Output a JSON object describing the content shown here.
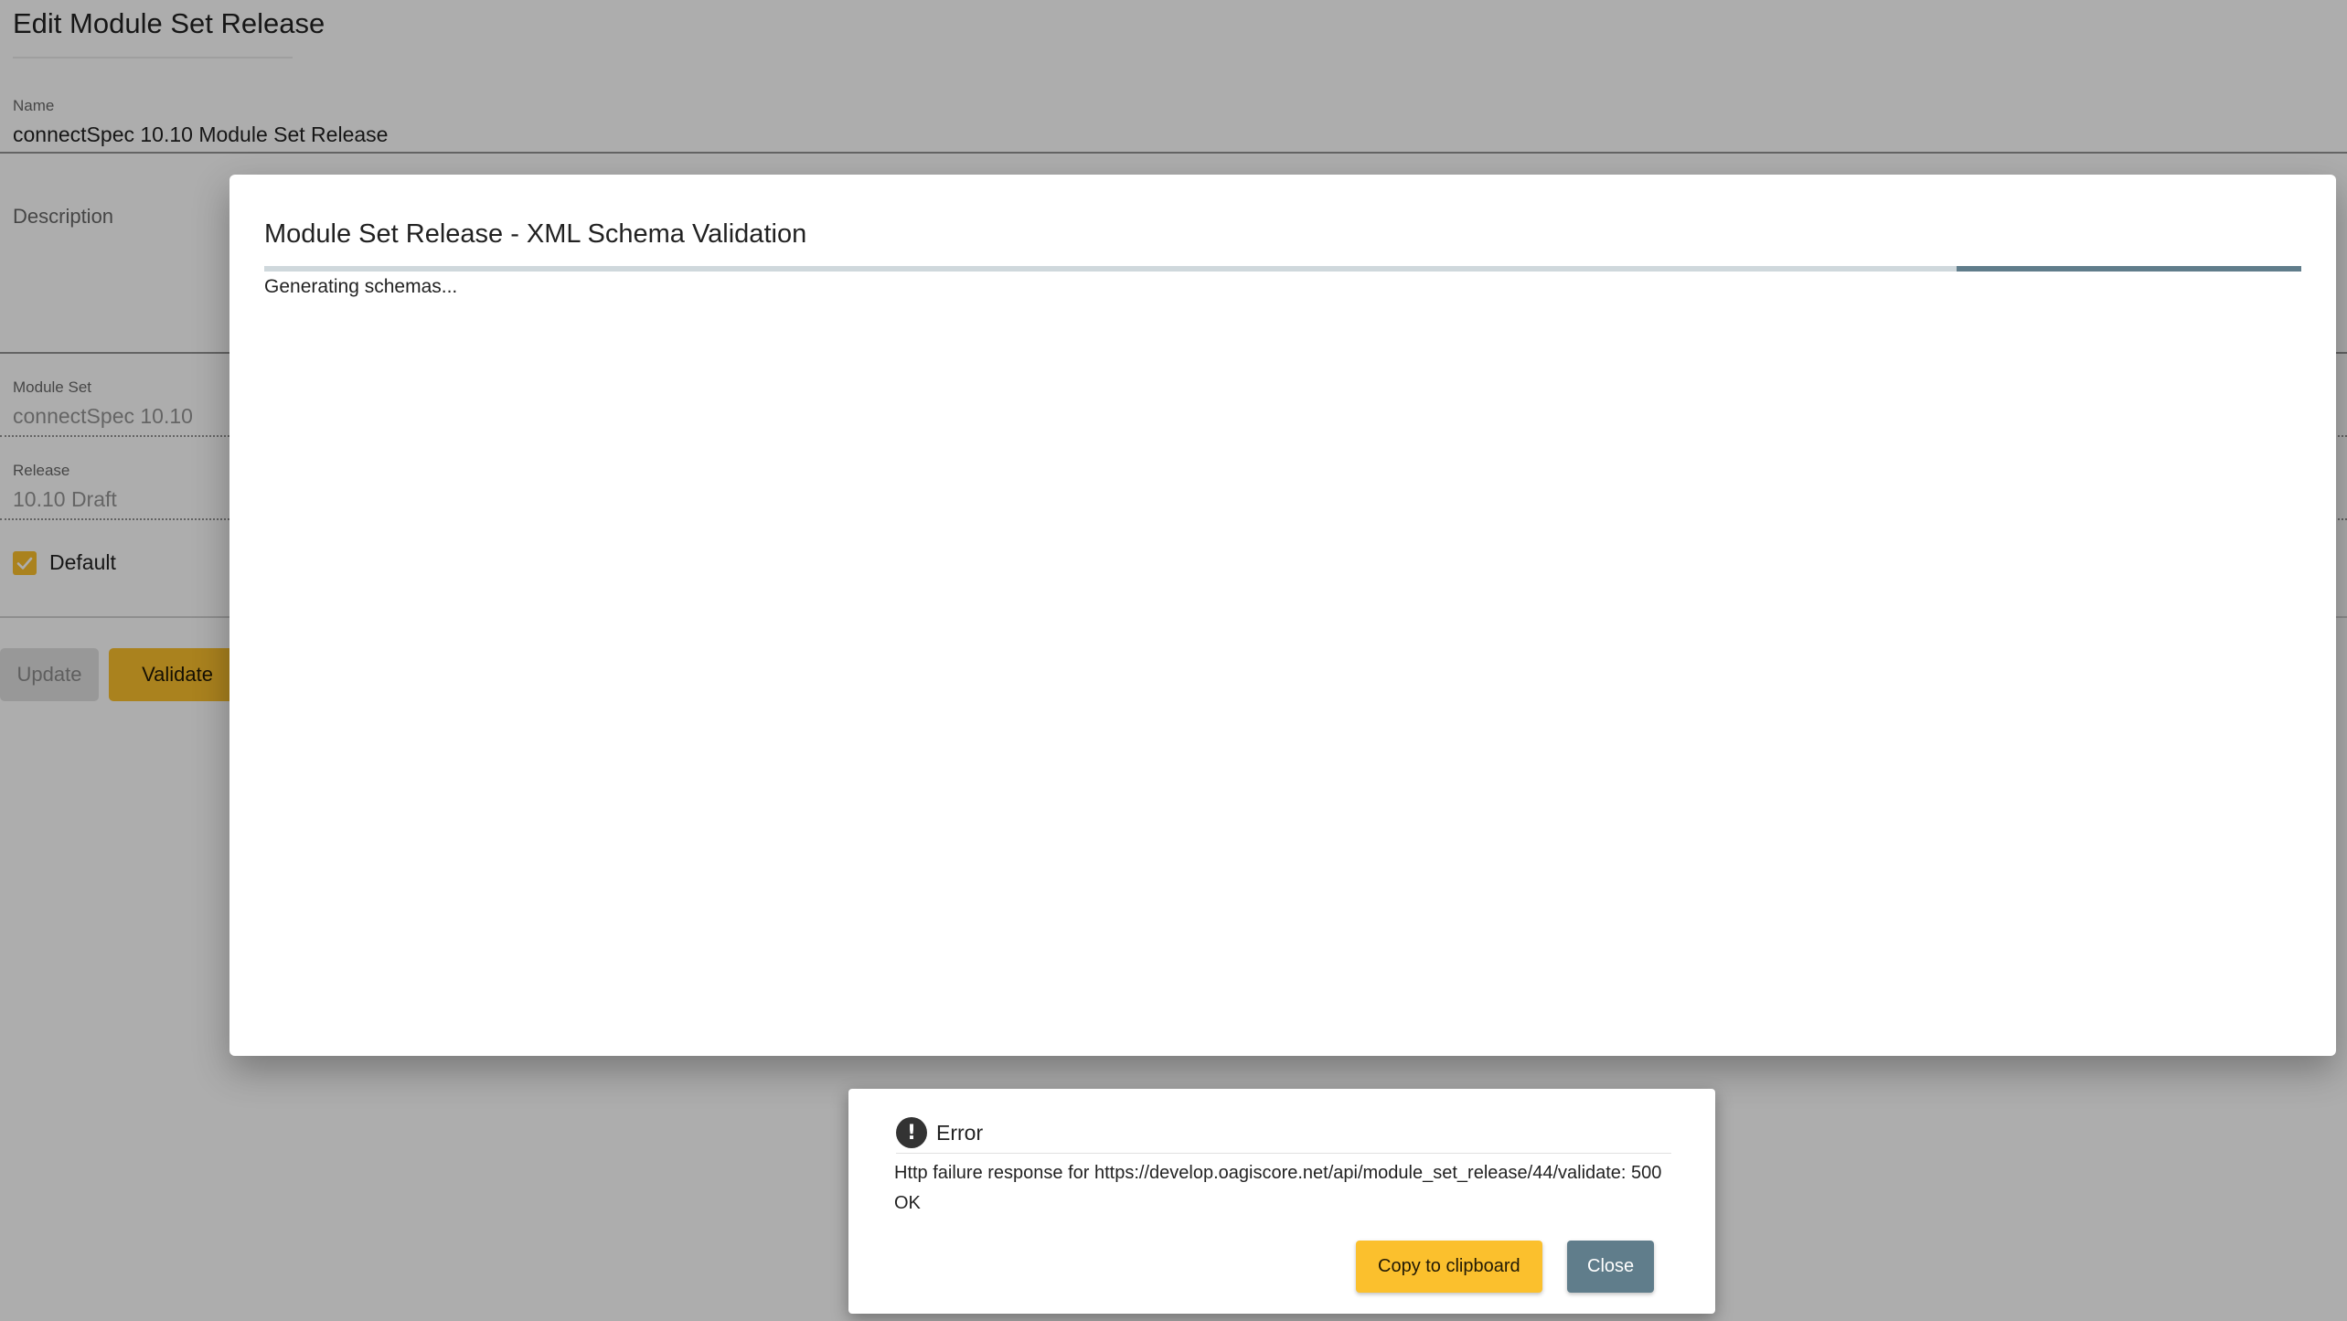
{
  "page": {
    "title": "Edit Module Set Release"
  },
  "form": {
    "name": {
      "label": "Name",
      "value": "connectSpec 10.10 Module Set Release"
    },
    "description": {
      "label": "Description",
      "value": ""
    },
    "module_set": {
      "label": "Module Set",
      "value": "connectSpec 10.10"
    },
    "release": {
      "label": "Release",
      "value": "10.10 Draft"
    },
    "default_checkbox": {
      "label": "Default",
      "checked": true
    },
    "buttons": {
      "update_label": "Update",
      "validate_label": "Validate"
    }
  },
  "validation_dialog": {
    "title": "Module Set Release - XML Schema Validation",
    "status_text": "Generating schemas...",
    "progress_mode": "indeterminate"
  },
  "error_dialog": {
    "icon": "exclamation-circle-icon",
    "title": "Error",
    "message": "Http failure response for https://develop.oagiscore.net/api/module_set_release/44/validate: 500 OK",
    "copy_label": "Copy to clipboard",
    "close_label": "Close"
  },
  "colors": {
    "accent": "#fbc02d",
    "primary": "#607d8b",
    "progress_track": "#cfd8dc"
  }
}
